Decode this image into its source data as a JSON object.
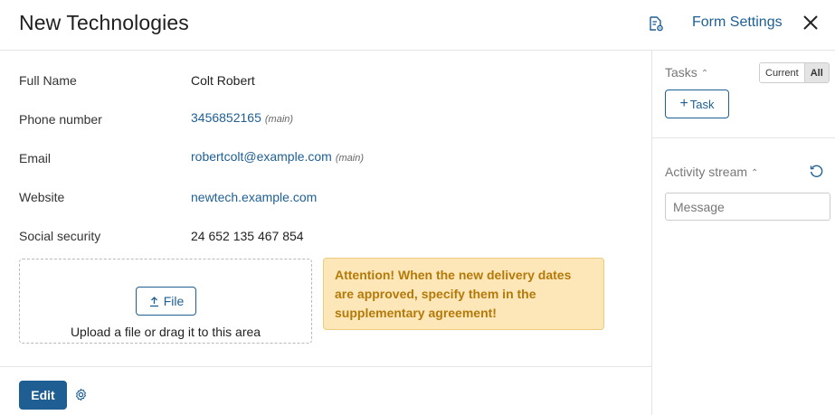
{
  "header": {
    "title": "New Technologies",
    "form_settings_label": "Form Settings"
  },
  "fields": [
    {
      "label": "Full Name",
      "value": "Colt Robert"
    },
    {
      "label": "Phone number",
      "value": "3456852165",
      "note": "(main)"
    },
    {
      "label": "Email",
      "value": "robertcolt@example.com",
      "note": "(main)"
    },
    {
      "label": "Website",
      "value": "newtech.example.com"
    },
    {
      "label": "Social security",
      "value": "24 652 135 467 854"
    }
  ],
  "upload": {
    "button_label": "File",
    "hint": "Upload a file or drag it to this area"
  },
  "attention": {
    "text": "Attention! When the new delivery dates are approved, specify them in the supplementary agreement!"
  },
  "footer": {
    "edit_label": "Edit"
  },
  "sidebar": {
    "tasks_label": "Tasks",
    "toggle": {
      "current": "Current",
      "all": "All",
      "selected": "All"
    },
    "task_button": "Task",
    "activity_label": "Activity stream",
    "message_placeholder": "Message"
  },
  "colors": {
    "accent": "#1e5f94",
    "attention_bg": "#fde7b9",
    "attention_text": "#b47a09"
  },
  "icons": {
    "header_doc": "document-settings-icon",
    "close": "close-icon",
    "upload": "upload-icon",
    "gear": "gear-icon",
    "refresh": "refresh-icon",
    "plus": "plus-icon",
    "caret": "chevron-up-icon"
  }
}
